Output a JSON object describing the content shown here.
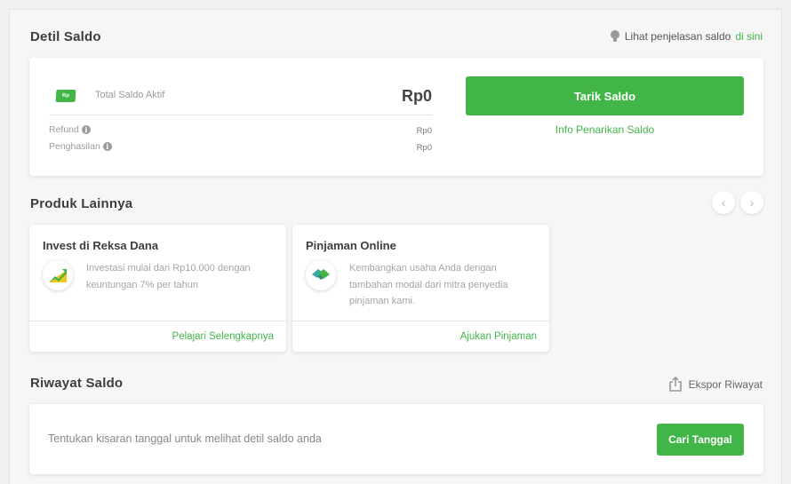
{
  "detil": {
    "title": "Detil Saldo",
    "hint_text": "Lihat penjelasan saldo",
    "hint_link": "di sini",
    "flag_label": "Rp",
    "total_label": "Total Saldo Aktif",
    "total_value": "Rp0",
    "refund_label": "Refund",
    "refund_value": "Rp0",
    "penghasilan_label": "Penghasilan",
    "penghasilan_value": "Rp0",
    "tarik_button": "Tarik Saldo",
    "info_link": "Info Penarikan Saldo"
  },
  "produk": {
    "title": "Produk Lainnya",
    "prev_arrow": "‹",
    "next_arrow": "›",
    "items": [
      {
        "title": "Invest di Reksa Dana",
        "desc_line1": "Investasi mulai dari Rp10.000 dengan",
        "desc_line2": "keuntungan 7% per tahun",
        "desc_line3": "",
        "link": "Pelajari Selengkapnya",
        "icon": "chart-up-icon"
      },
      {
        "title": "Pinjaman Online",
        "desc_line1": "Kembangkan usaha Anda dengan",
        "desc_line2": "tambahan modal dari mitra penyedia",
        "desc_line3": "pinjaman kami.",
        "link": "Ajukan Pinjaman",
        "icon": "handshake-icon"
      }
    ]
  },
  "riwayat": {
    "title": "Riwayat Saldo",
    "export_label": "Ekspor Riwayat",
    "date_hint": "Tentukan kisaran tanggal untuk melihat detil saldo anda",
    "cari_button": "Cari Tanggal"
  },
  "colors": {
    "accent": "#42b549",
    "background": "#f6f6f6"
  }
}
